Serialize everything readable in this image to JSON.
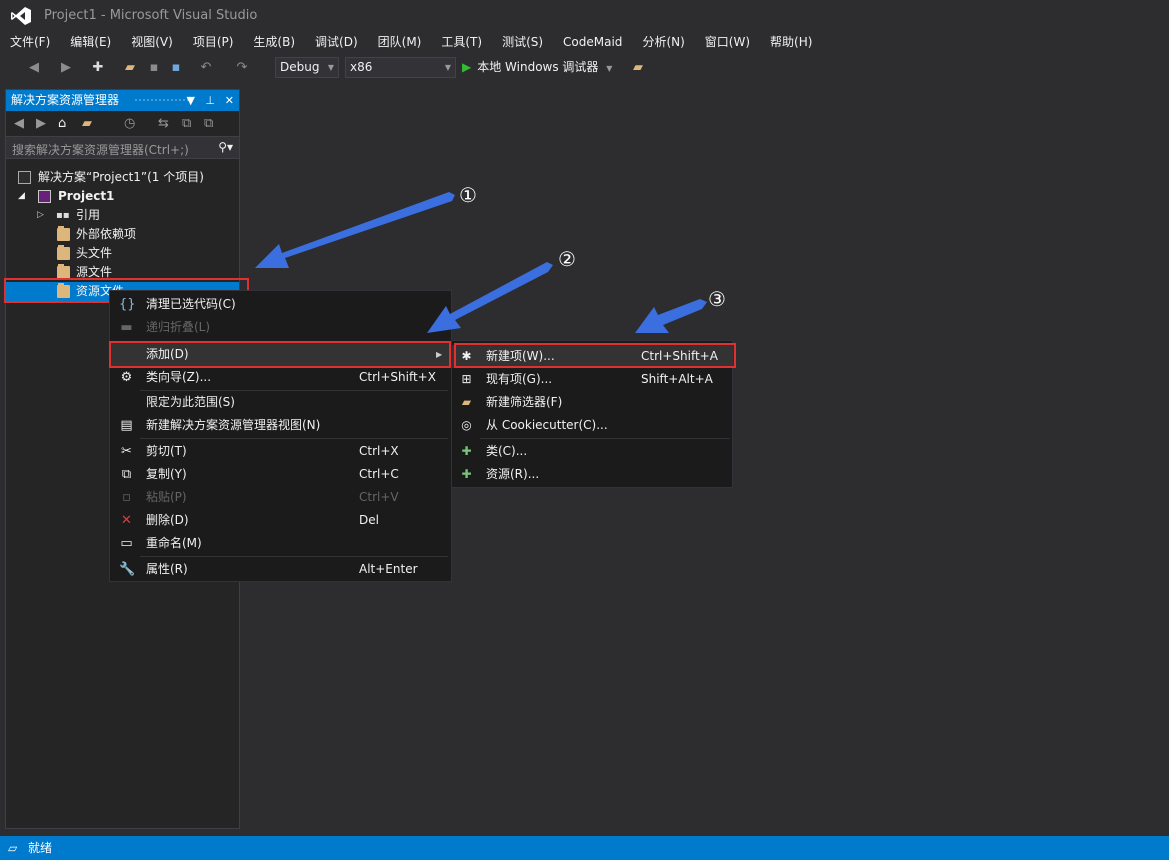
{
  "window": {
    "title": "Project1 - Microsoft Visual Studio"
  },
  "menubar": [
    "文件(F)",
    "编辑(E)",
    "视图(V)",
    "项目(P)",
    "生成(B)",
    "调试(D)",
    "团队(M)",
    "工具(T)",
    "测试(S)",
    "CodeMaid",
    "分析(N)",
    "窗口(W)",
    "帮助(H)"
  ],
  "toolbar": {
    "config": "Debug",
    "platform": "x86",
    "run_label": "本地 Windows 调试器"
  },
  "solution_explorer": {
    "title": "解决方案资源管理器",
    "search_placeholder": "搜索解决方案资源管理器(Ctrl+;)",
    "tree": {
      "solution": "解决方案“Project1”(1 个项目)",
      "project": "Project1",
      "references": "引用",
      "external_deps": "外部依赖项",
      "header_files": "头文件",
      "source_files": "源文件",
      "resource_files": "资源文件"
    }
  },
  "context_menu": {
    "items": [
      {
        "label": "清理已选代码(C)",
        "shortcut": "",
        "icon": "braces-icon"
      },
      {
        "label": "递归折叠(L)",
        "shortcut": "",
        "icon": "collapse-icon",
        "disabled": true
      },
      {
        "label": "添加(D)",
        "shortcut": "",
        "icon": "",
        "submenu": true
      },
      {
        "label": "类向导(Z)...",
        "shortcut": "Ctrl+Shift+X",
        "icon": "wizard-icon"
      },
      {
        "label": "限定为此范围(S)",
        "shortcut": "",
        "icon": ""
      },
      {
        "label": "新建解决方案资源管理器视图(N)",
        "shortcut": "",
        "icon": "new-view-icon"
      },
      {
        "label": "剪切(T)",
        "shortcut": "Ctrl+X",
        "icon": "scissors-icon"
      },
      {
        "label": "复制(Y)",
        "shortcut": "Ctrl+C",
        "icon": "copy-icon"
      },
      {
        "label": "粘贴(P)",
        "shortcut": "Ctrl+V",
        "icon": "paste-icon",
        "disabled": true
      },
      {
        "label": "删除(D)",
        "shortcut": "Del",
        "icon": "delete-icon"
      },
      {
        "label": "重命名(M)",
        "shortcut": "",
        "icon": "rename-icon"
      },
      {
        "label": "属性(R)",
        "shortcut": "Alt+Enter",
        "icon": "wrench-icon"
      }
    ]
  },
  "submenu": {
    "items": [
      {
        "label": "新建项(W)...",
        "shortcut": "Ctrl+Shift+A",
        "icon": "new-item-icon"
      },
      {
        "label": "现有项(G)...",
        "shortcut": "Shift+Alt+A",
        "icon": "existing-item-icon"
      },
      {
        "label": "新建筛选器(F)",
        "shortcut": "",
        "icon": "new-filter-icon"
      },
      {
        "label": "从 Cookiecutter(C)...",
        "shortcut": "",
        "icon": "cookiecutter-icon"
      },
      {
        "label": "类(C)...",
        "shortcut": "",
        "icon": "class-icon"
      },
      {
        "label": "资源(R)...",
        "shortcut": "",
        "icon": "resource-icon"
      }
    ]
  },
  "annotations": {
    "step1": "①",
    "step2": "②",
    "step3": "③"
  },
  "statusbar": {
    "text": "就绪"
  },
  "colors": {
    "accent": "#007acc",
    "highlight_box": "#e03030",
    "arrow": "#3b6fe0",
    "background": "#2d2d30"
  }
}
